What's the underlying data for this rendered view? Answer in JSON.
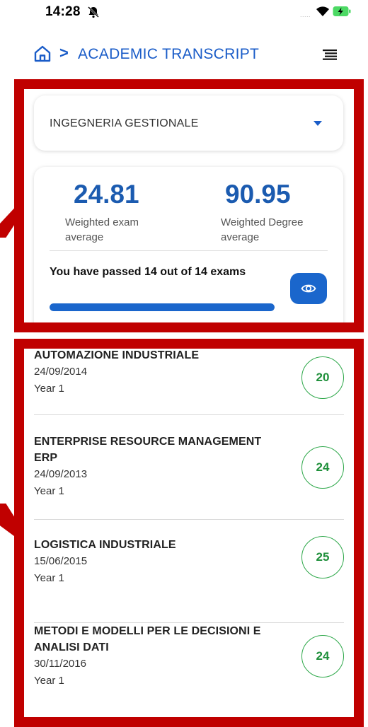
{
  "status_bar": {
    "time": "14:28",
    "signal_dots": "....."
  },
  "header": {
    "title": "ACADEMIC TRANSCRIPT",
    "separator": ">"
  },
  "course_select": {
    "selected": "INGEGNERIA GESTIONALE"
  },
  "stats": {
    "weighted_exam_average": "24.81",
    "weighted_exam_average_label": "Weighted exam average",
    "weighted_degree_average": "90.95",
    "weighted_degree_average_label": "Weighted Degree average",
    "passed_text": "You have passed 14 out of 14 exams",
    "passed": 14,
    "total": 14,
    "progress_fraction": 1.0
  },
  "exams": [
    {
      "name": "AUTOMAZIONE INDUSTRIALE",
      "date": "24/09/2014",
      "year": "Year 1",
      "grade": "20"
    },
    {
      "name": "ENTERPRISE RESOURCE MANAGEMENT ERP",
      "date": "24/09/2013",
      "year": "Year 1",
      "grade": "24"
    },
    {
      "name": "LOGISTICA INDUSTRIALE",
      "date": "15/06/2015",
      "year": "Year 1",
      "grade": "25"
    },
    {
      "name": "METODI E MODELLI PER LE DECISIONI E ANALISI DATI",
      "date": "30/11/2016",
      "year": "Year 1",
      "grade": "24"
    }
  ],
  "colors": {
    "accent": "#1a5cc8",
    "highlight_frame": "#c00000",
    "grade": "#1e8f3a"
  }
}
